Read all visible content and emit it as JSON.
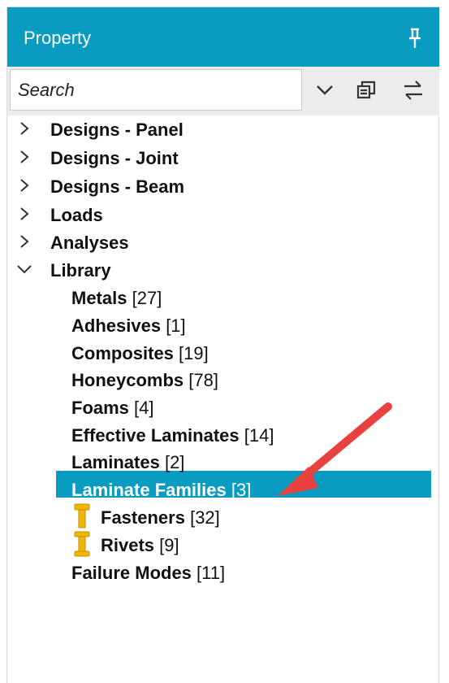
{
  "header": {
    "title": "Property"
  },
  "search": {
    "placeholder": "Search"
  },
  "tree": {
    "top_items": [
      {
        "label": "Designs - Panel",
        "expanded": false
      },
      {
        "label": "Designs - Joint",
        "expanded": false
      },
      {
        "label": "Designs - Beam",
        "expanded": false
      },
      {
        "label": "Loads",
        "expanded": false
      },
      {
        "label": "Analyses",
        "expanded": false
      },
      {
        "label": "Library",
        "expanded": true
      }
    ],
    "library_items": [
      {
        "label": "Metals",
        "count": "[27]"
      },
      {
        "label": "Adhesives",
        "count": "[1]"
      },
      {
        "label": "Composites",
        "count": "[19]"
      },
      {
        "label": "Honeycombs",
        "count": "[78]"
      },
      {
        "label": "Foams",
        "count": "[4]"
      },
      {
        "label": "Effective Laminates",
        "count": "[14]"
      },
      {
        "label": "Laminates",
        "count": "[2]"
      },
      {
        "label": "Laminate Families",
        "count": "[3]",
        "selected": true
      },
      {
        "label": "Fasteners",
        "count": "[32]",
        "icon": "fastener-icon"
      },
      {
        "label": "Rivets",
        "count": "[9]",
        "icon": "rivet-icon"
      },
      {
        "label": "Failure Modes",
        "count": "[11]"
      }
    ]
  },
  "colors": {
    "accent": "#0a9cc0",
    "arrow": "#e8413f",
    "icon_gold": "#f2b705"
  }
}
